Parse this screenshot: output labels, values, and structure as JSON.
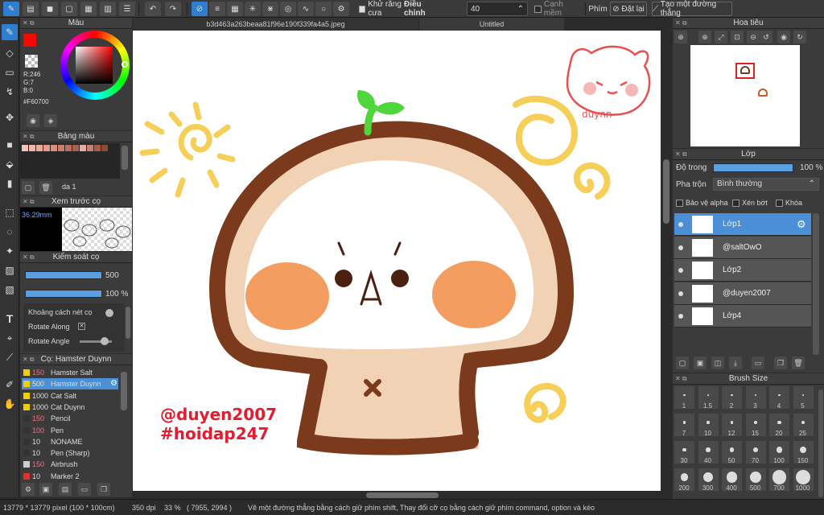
{
  "toolbar": {
    "antialias_label": "Khử răng cưa",
    "adjust_label": "Điều chỉnh",
    "adjust_value": "40",
    "edge_label": "Cạnh mềm",
    "keys_label": "Phím",
    "reset_label": "Đặt lại",
    "line_label": "Tạo một đường thẳng"
  },
  "tabs": {
    "file1": "b3d463a263beaa81f96e190f339fa4a5.jpeg",
    "file2": "Untitled"
  },
  "color_panel": {
    "title": "Màu",
    "r": "R:246",
    "g": "G:7",
    "b": "B:0",
    "hex": "#F60700",
    "primary": "#F60700"
  },
  "palette_panel": {
    "title": "Bảng màu",
    "set_name": "da 1",
    "swatches": [
      "#f2c4b8",
      "#f2b6a6",
      "#eeaa98",
      "#e89c8a",
      "#d8907c",
      "#c8806c",
      "#b87060",
      "#a86050",
      "#e0b0a0",
      "#c88070",
      "#a85c48",
      "#8c4a38"
    ]
  },
  "preview_panel": {
    "title": "Xem trước cọ",
    "size": "36.29mm"
  },
  "brush_control": {
    "title": "Kiểm soát cọ",
    "size_value": "500",
    "opacity_value": "100 %",
    "spacing_label": "Khoảng cách nét cọ",
    "rotate_along_label": "Rotate Along",
    "rotate_angle_label": "Rotate Angle"
  },
  "brush_list": {
    "title": "Cọ: Hamster Duynn",
    "items": [
      {
        "size": "150",
        "name": "Hamster Salt",
        "color": "#f0d000"
      },
      {
        "size": "500",
        "name": "Hamster Duynn",
        "color": "#f0d000"
      },
      {
        "size": "1000",
        "name": "Cat Salt",
        "color": "#f0d000"
      },
      {
        "size": "1000",
        "name": "Cat Duynn",
        "color": "#f0d000"
      },
      {
        "size": "150",
        "name": "Pencil",
        "color": "#333333"
      },
      {
        "size": "100",
        "name": "Pen",
        "color": "#333333"
      },
      {
        "size": "10",
        "name": "NONAME",
        "color": "#333333"
      },
      {
        "size": "10",
        "name": "Pen (Sharp)",
        "color": "#333333"
      },
      {
        "size": "150",
        "name": "Airbrush",
        "color": "#cccccc"
      },
      {
        "size": "10",
        "name": "Marker 2",
        "color": "#e03030"
      }
    ]
  },
  "canvas_text": {
    "tag1": "@duyen2007",
    "tag2": "#hoidap247",
    "logo": "duynn"
  },
  "navigator": {
    "title": "Hoa tiêu"
  },
  "layers_panel": {
    "title": "Lớp",
    "opacity_label": "Độ trong",
    "opacity_value": "100 %",
    "blend_label": "Pha trộn",
    "blend_value": "Bình thường",
    "protect_alpha": "Bảo vệ alpha",
    "clipping": "Xén bớt",
    "lock": "Khóa",
    "layers": [
      {
        "name": "Lớp1",
        "selected": true
      },
      {
        "name": "@saltOwO",
        "selected": false
      },
      {
        "name": "Lớp2",
        "selected": false
      },
      {
        "name": "@duyen2007",
        "selected": false
      },
      {
        "name": "Lớp4",
        "selected": false
      }
    ]
  },
  "brush_size_panel": {
    "title": "Brush Size",
    "sizes": [
      "1",
      "1.5",
      "2",
      "3",
      "4",
      "5",
      "7",
      "10",
      "12",
      "15",
      "20",
      "25",
      "30",
      "40",
      "50",
      "70",
      "100",
      "150",
      "200",
      "300",
      "400",
      "500",
      "700",
      "1000"
    ]
  },
  "statusbar": {
    "dims": "13779 * 13779 pixel  (100 * 100cm)",
    "dpi": "350 dpi",
    "zoom": "33 %",
    "coords": "( 7955, 2994 )",
    "hint": "Vẽ một đường thẳng bằng cách giữ phím shift, Thay đổi cỡ cọ bằng cách giữ phím command, option và kéo"
  }
}
